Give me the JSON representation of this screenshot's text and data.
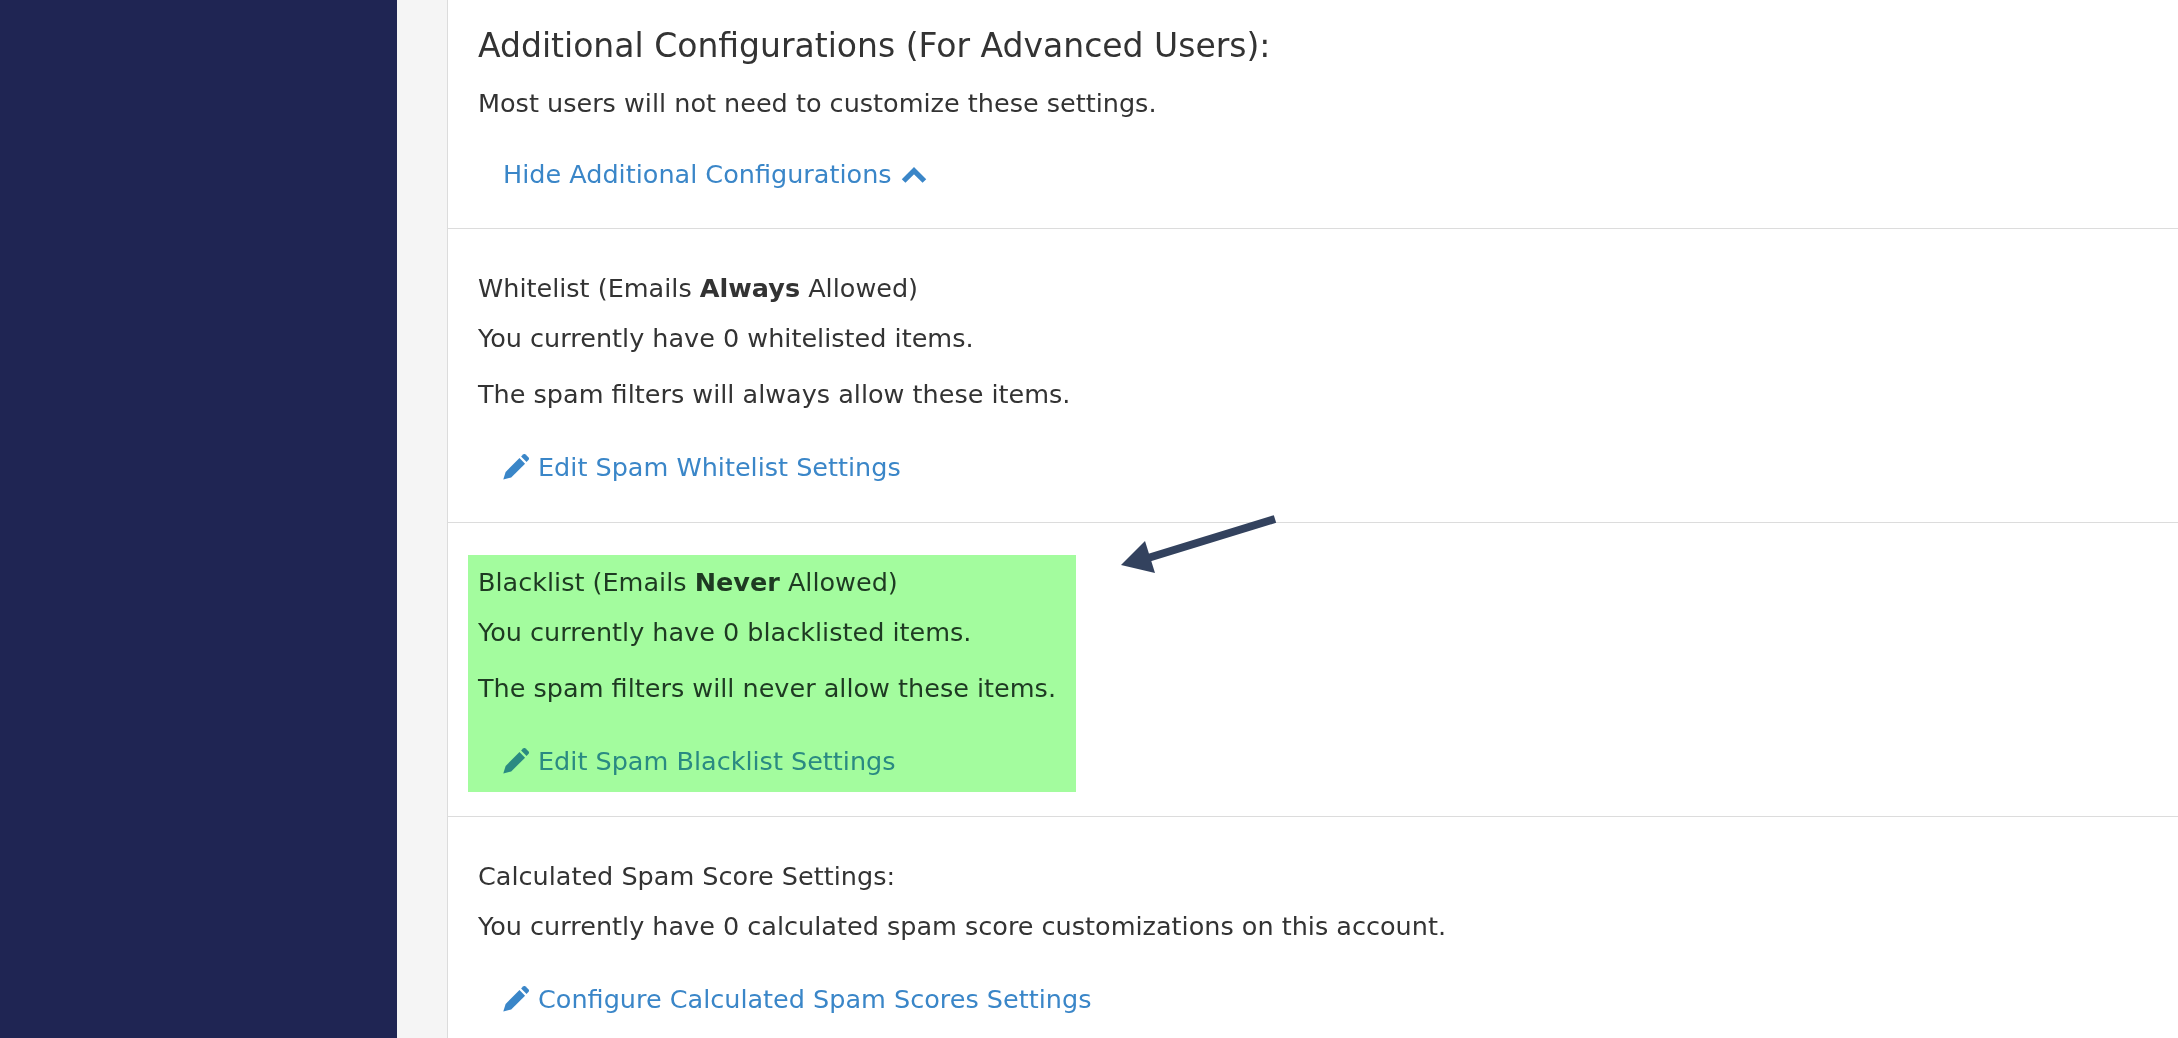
{
  "header": {
    "title": "Additional Configurations (For Advanced Users):",
    "description": "Most users will not need to customize these settings.",
    "toggle": {
      "label": "Hide Additional Configurations",
      "expanded": true
    }
  },
  "sections": [
    {
      "title": "Whitelist (Emails **Always** Allowed)",
      "lines": [
        "You currently have 0 whitelisted items.",
        "The spam filters will always allow these items."
      ],
      "link": "Edit Spam Whitelist Settings",
      "highlighted": false
    },
    {
      "title": "Blacklist (Emails **Never** Allowed)",
      "lines": [
        "You currently have 0 blacklisted items.",
        "The spam filters will never allow these items."
      ],
      "link": "Edit Spam Blacklist Settings",
      "highlighted": true
    },
    {
      "title": "Calculated Spam Score Settings:",
      "lines": [
        "You currently have 0 calculated spam score customizations on this account."
      ],
      "link": "Configure Calculated Spam Scores Settings",
      "highlighted": false
    }
  ]
}
